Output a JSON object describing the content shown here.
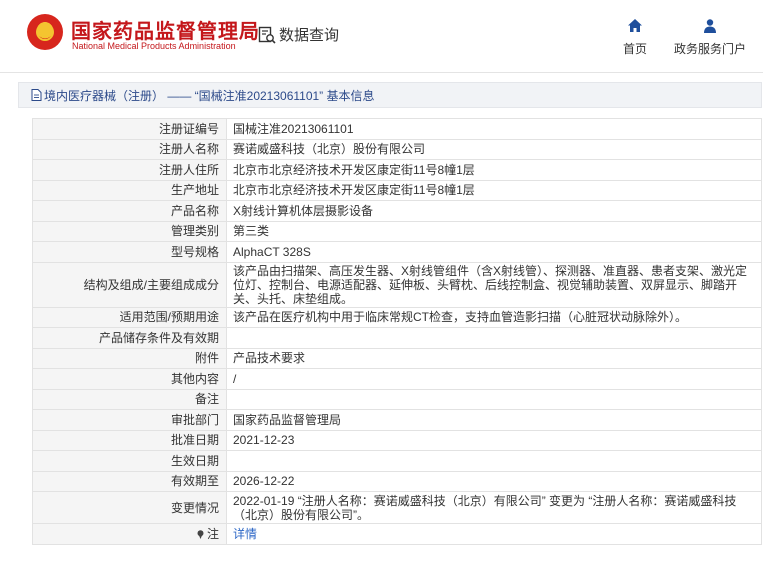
{
  "header": {
    "brand_cn": "国家药品监督管理局",
    "brand_en": "National Medical Products Administration",
    "query_label": "数据查询",
    "home_label": "首页",
    "portal_label": "政务服务门户"
  },
  "breadcrumb": "境内医疗器械（注册） —— “国械注准20213061101” 基本信息",
  "rows": [
    {
      "label": "注册证编号",
      "value": "国械注准20213061101"
    },
    {
      "label": "注册人名称",
      "value": "赛诺威盛科技（北京）股份有限公司"
    },
    {
      "label": "注册人住所",
      "value": "北京市北京经济技术开发区康定街11号8幢1层"
    },
    {
      "label": "生产地址",
      "value": "北京市北京经济技术开发区康定街11号8幢1层"
    },
    {
      "label": "产品名称",
      "value": "X射线计算机体层摄影设备"
    },
    {
      "label": "管理类别",
      "value": "第三类"
    },
    {
      "label": "型号规格",
      "value": "AlphaCT 328S"
    },
    {
      "label": "结构及组成/主要组成成分",
      "value": "该产品由扫描架、高压发生器、X射线管组件（含X射线管）、探测器、准直器、患者支架、激光定位灯、控制台、电源适配器、延伸板、头臂枕、后线控制盒、视觉辅助装置、双屏显示、脚踏开关、头托、床垫组成。"
    },
    {
      "label": "适用范围/预期用途",
      "value": "该产品在医疗机构中用于临床常规CT检查，支持血管造影扫描（心脏冠状动脉除外）。"
    },
    {
      "label": "产品储存条件及有效期",
      "value": ""
    },
    {
      "label": "附件",
      "value": "产品技术要求"
    },
    {
      "label": "其他内容",
      "value": "/"
    },
    {
      "label": "备注",
      "value": ""
    },
    {
      "label": "审批部门",
      "value": "国家药品监督管理局"
    },
    {
      "label": "批准日期",
      "value": "2021-12-23"
    },
    {
      "label": "生效日期",
      "value": ""
    },
    {
      "label": "有效期至",
      "value": "2026-12-22"
    },
    {
      "label": "变更情况",
      "value": "2022-01-19 “注册人名称：赛诺威盛科技（北京）有限公司” 变更为 “注册人名称：赛诺威盛科技（北京）股份有限公司”。"
    },
    {
      "label": "注",
      "value": "详情"
    }
  ],
  "colors": {
    "brand_red": "#c4171b",
    "link_blue": "#2b66c6",
    "breadcrumb_text": "#2c4a8a"
  }
}
